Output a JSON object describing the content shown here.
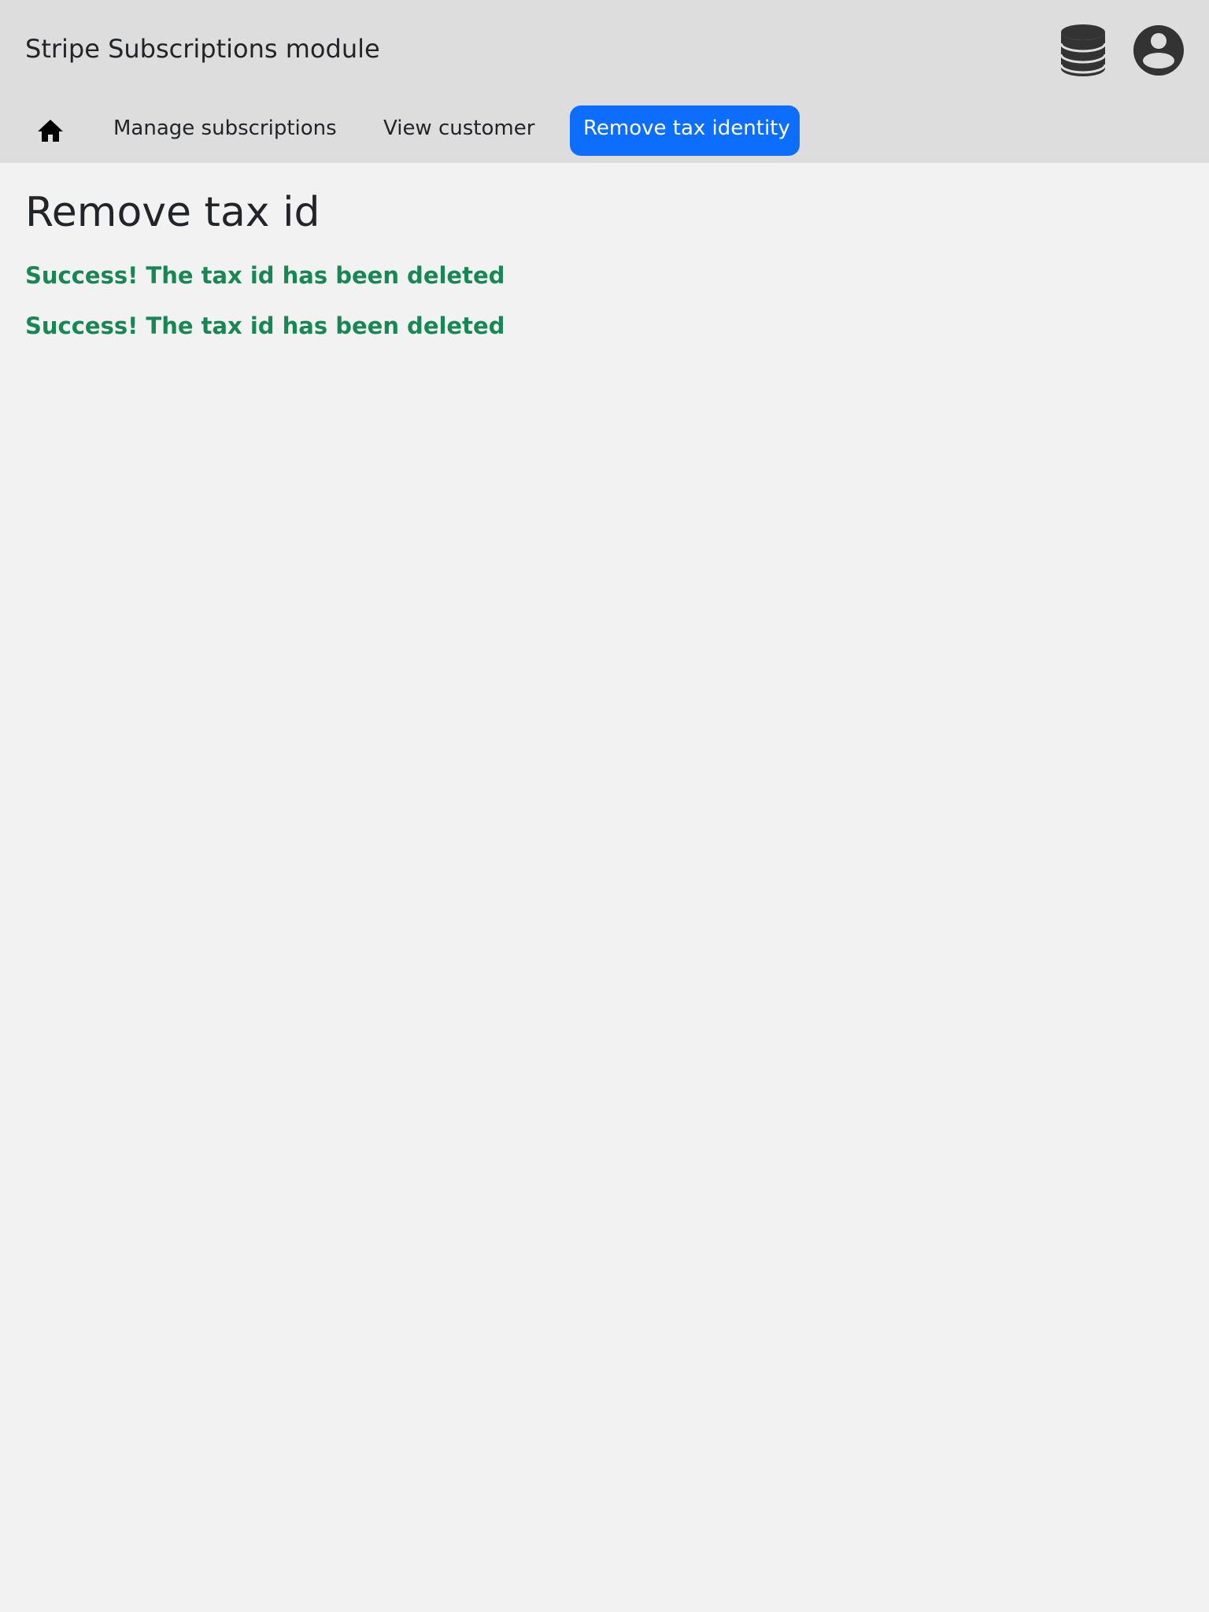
{
  "header": {
    "app_title": "Stripe Subscriptions module",
    "icons": [
      "database-icon",
      "user-circle-icon"
    ],
    "icon_color": "#333333",
    "background": "#dddddd"
  },
  "nav": {
    "home_icon": "home-icon",
    "items": [
      {
        "label": "Manage subscriptions",
        "active": false
      },
      {
        "label": "View customer",
        "active": false
      },
      {
        "label": "Remove tax identity",
        "active": true
      }
    ],
    "active_color": "#0d6efd"
  },
  "main": {
    "heading": "Remove tax id",
    "messages": [
      "Success! The tax id has been deleted",
      "Success! The tax id has been deleted"
    ],
    "success_color": "#198754"
  }
}
